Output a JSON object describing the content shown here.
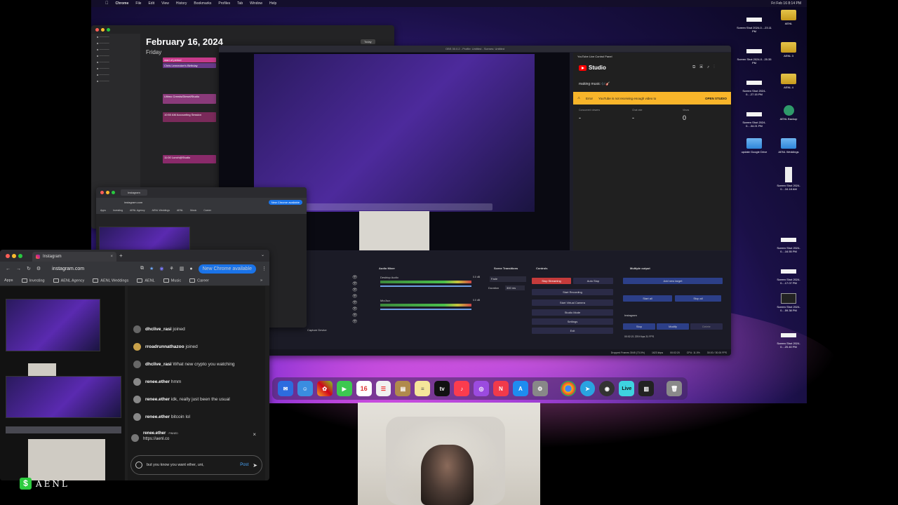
{
  "menubar": {
    "app": "Chrome",
    "items": [
      "File",
      "Edit",
      "View",
      "History",
      "Bookmarks",
      "Profiles",
      "Tab",
      "Window",
      "Help"
    ],
    "clock": "Fri Feb 16  8:14 PM"
  },
  "calendar": {
    "date": "February 16, 2024",
    "weekday": "Friday",
    "today_button": "Today",
    "events": [
      "start of period",
      "Chris Lennecker's Birthday",
      "Ultimo Creeds/Diesel/Studio",
      "10:50 AM Accounting Session",
      "11:00 Lunch@Studio"
    ]
  },
  "obs": {
    "title": "OBS 30.0.2 - Profile: Untitled - Scenes: Untitled",
    "docks": {
      "audio_mixer": "Audio Mixer",
      "scene_transitions": "Scene Transitions",
      "controls": "Controls",
      "multiple_output": "Multiple output"
    },
    "mixer": [
      {
        "name": "Desktop Audio",
        "db": "0.0 dB"
      },
      {
        "name": "Mic/Aux",
        "db": "0.0 dB"
      }
    ],
    "transition": {
      "type": "Fade",
      "duration_label": "Duration",
      "duration": "300 ms"
    },
    "controls": [
      "Stop Streaming",
      "Start Recording",
      "Start Virtual Camera",
      "Studio Mode",
      "Settings",
      "Exit"
    ],
    "auto_stop": "Auto Stop",
    "multi_output": {
      "add_target": "Add new target",
      "start_all": "Start all",
      "stop_all": "Stop all",
      "target": "Instagram",
      "stop": "Stop",
      "modify": "Modify",
      "delete": "Delete",
      "stats": "00:02:21  225 Kbps  31 FPS"
    },
    "status": {
      "dropped": "Dropped Frames 3045 (73.0%)",
      "bitrate": "1623 kbps",
      "time": "00:02:20",
      "cpu": "CPU: 11.0%",
      "fps": "30.00 / 30.00 FPS"
    }
  },
  "youtube": {
    "panel_title": "YouTube Live Control Panel",
    "brand": "Studio",
    "stream_title": "making music 🎶🎸",
    "error_label": "Error",
    "error_text": "YouTube is not receiving enough video to",
    "open_studio": "OPEN STUDIO",
    "stats": [
      {
        "label": "Concurrent viewers",
        "value": "-"
      },
      {
        "label": "Chat rate",
        "value": "-"
      },
      {
        "label": "Views",
        "value": "0"
      }
    ]
  },
  "chrome_back": {
    "tab": "Instagram",
    "url": "instagram.com",
    "new_chrome": "New Chrome available",
    "bookmarks": [
      "Apps",
      "Investing",
      "AENL Agency",
      "AENL Weddings",
      "AENL",
      "Music",
      "Career"
    ]
  },
  "chrome": {
    "tab": "Instagram",
    "url": "instagram.com",
    "new_chrome": "New Chrome available",
    "bookmarks": [
      "Apps",
      "Investing",
      "AENL Agency",
      "AENL Weddings",
      "AENL",
      "Music",
      "Career"
    ]
  },
  "chat": {
    "messages": [
      {
        "user": "dhclive_rasi",
        "text": "joined"
      },
      {
        "user": "rroadrunnathazoo",
        "text": "joined"
      },
      {
        "user": "dhclive_rasi",
        "text": "What new crypto you watching"
      },
      {
        "user": "renee.ether",
        "text": "hmm"
      },
      {
        "user": "renee.ether",
        "text": "idk, really just been the usual"
      },
      {
        "user": "renee.ether",
        "text": "bitcoin lol"
      }
    ],
    "pinned": {
      "user": "renee.ether",
      "tag": "· PINNED",
      "text": "https://aenl.co"
    },
    "compose_text": "but you know you want ether, uni,",
    "post": "Post"
  },
  "desktop_icons": [
    {
      "label": "Screen Shot 2024-0....23.11 PM",
      "kind": "shot"
    },
    {
      "label": "AENL",
      "kind": "folder"
    },
    {
      "label": "Screen Shot 2024-0...25.35 PM",
      "kind": "shot"
    },
    {
      "label": "AENL 3",
      "kind": "folder"
    },
    {
      "label": "Screen Shot 2024-0....27.15 PM",
      "kind": "shot"
    },
    {
      "label": "AENL 4",
      "kind": "folder"
    },
    {
      "label": "Screen Shot 2024-0....34.21 PM",
      "kind": "shot"
    },
    {
      "label": "AENL Backup",
      "kind": "tm"
    },
    {
      "label": "update Google Drive",
      "kind": "bluefolder"
    },
    {
      "label": "AENL Weddings",
      "kind": "bluefolder"
    },
    {
      "label": "Screen Shot 2024-0....34.18 AM",
      "kind": "shot"
    },
    {
      "label": "Screen Shot 2024-0....16.55 PM",
      "kind": "shot"
    },
    {
      "label": "Screen Shot 2024-0....17.07 PM",
      "kind": "shot"
    },
    {
      "label": "Screen Shot 2024-0....59.38 PM",
      "kind": "shot"
    },
    {
      "label": "Screen Shot 2024-0....20.40 PM",
      "kind": "shot"
    }
  ],
  "dock": {
    "calendar_day": "16",
    "live_label": "Live"
  },
  "brand_logo": {
    "letter": "$",
    "word": "AENL"
  }
}
